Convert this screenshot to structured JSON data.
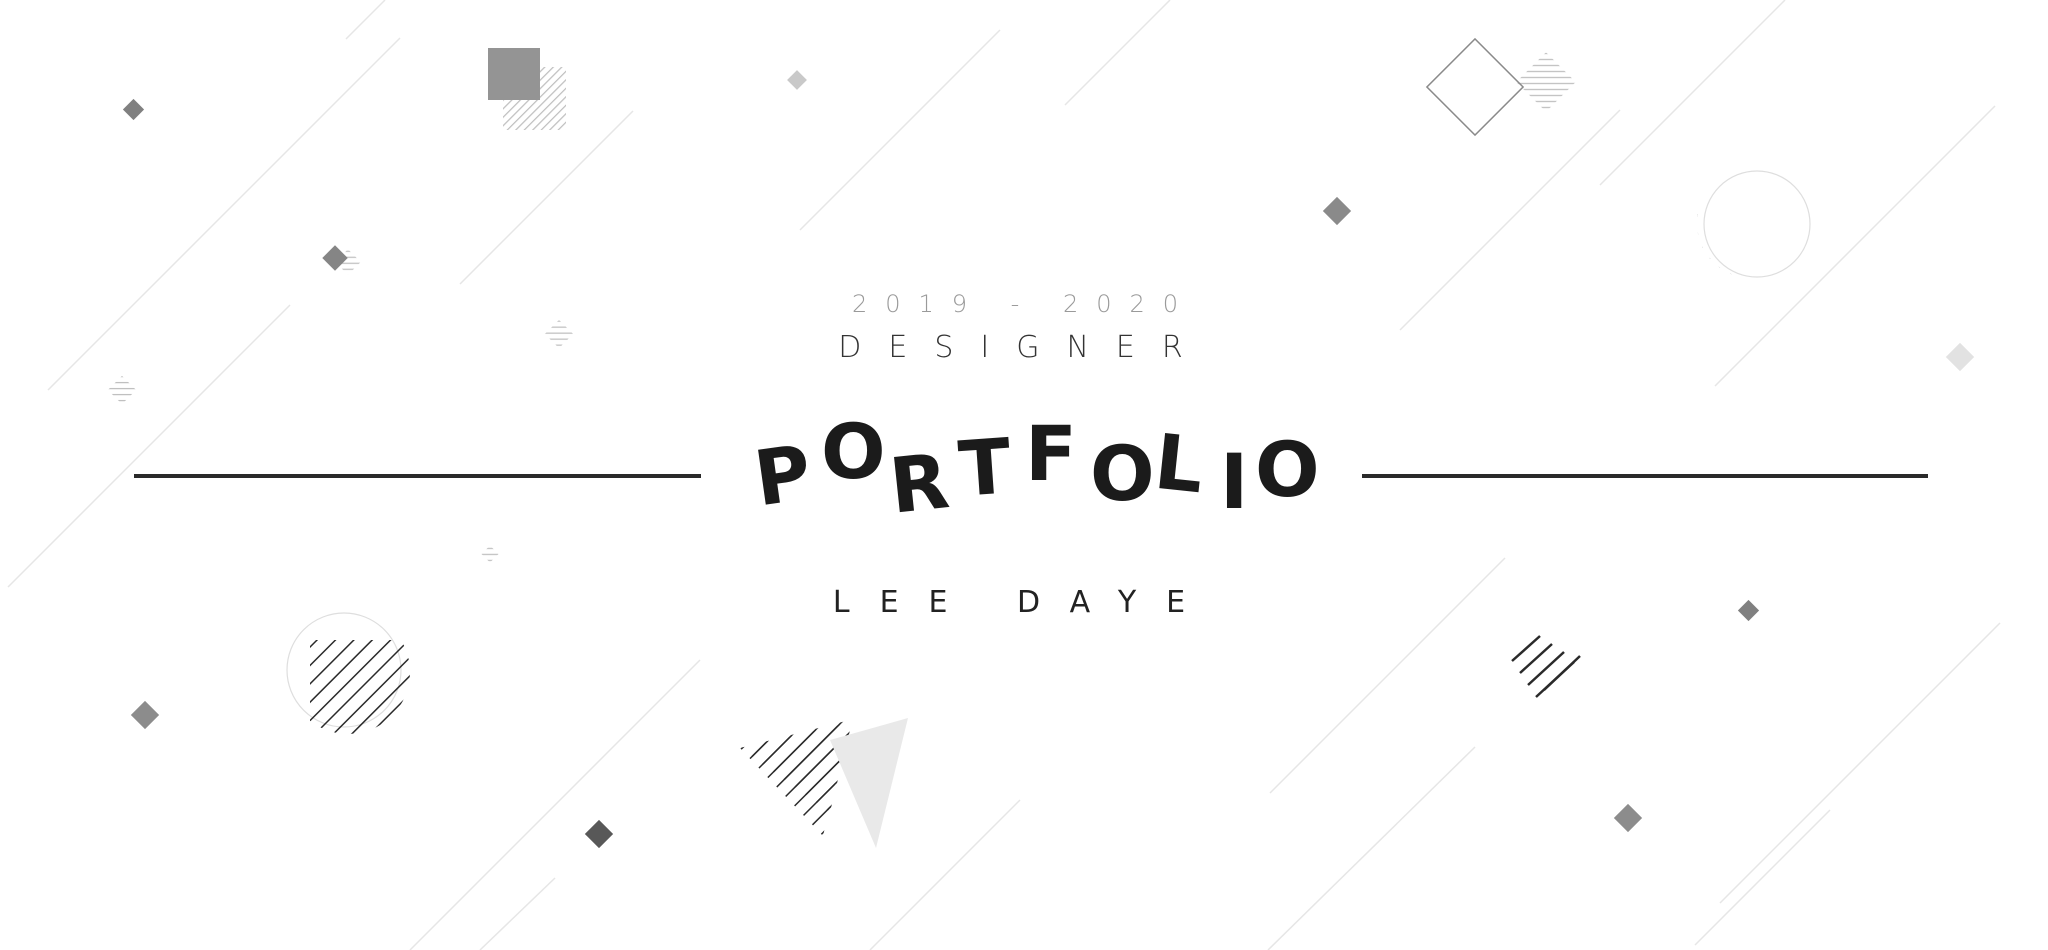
{
  "cover": {
    "years": "2019 - 2020",
    "role": "DESIGNER",
    "title": "PORTFOLIO",
    "title_letters": [
      "P",
      "O",
      "R",
      "T",
      "F",
      "O",
      "L",
      "I",
      "O"
    ],
    "name": "LEE DAYE"
  },
  "colors": {
    "background": "#ffffff",
    "ink": "#1b1b1b",
    "rule": "#2a2a2a",
    "shape_dark": "#555555",
    "shape_mid": "#8c8c8c",
    "shape_light": "#c8c8c8",
    "shape_pale": "#e9e9e9",
    "diagonal_line": "#e6e6e6"
  }
}
